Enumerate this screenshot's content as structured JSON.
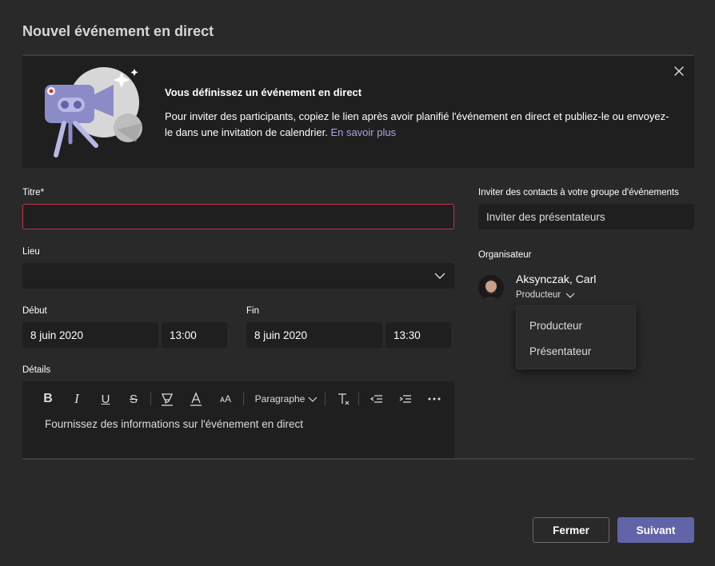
{
  "dialog": {
    "title": "Nouvel événement en direct"
  },
  "banner": {
    "title": "Vous définissez un événement en direct",
    "text": "Pour inviter des participants, copiez le lien après avoir planifié l'événement en direct et publiez-le ou envoyez-le dans une invitation de calendrier.",
    "link": "En savoir plus"
  },
  "form": {
    "title_label": "Titre*",
    "title_value": "",
    "location_label": "Lieu",
    "start_label": "Début",
    "start_date": "8 juin 2020",
    "start_time": "13:00",
    "end_label": "Fin",
    "end_date": "8 juin 2020",
    "end_time": "13:30",
    "details_label": "Détails",
    "details_placeholder": "Fournissez des informations sur l'événement en direct",
    "toolbar": {
      "paragraph": "Paragraphe"
    }
  },
  "invite": {
    "label": "Inviter des contacts à votre groupe d'événements",
    "placeholder": "Inviter des présentateurs"
  },
  "organizer": {
    "label": "Organisateur",
    "name": "Aksynczak, Carl",
    "role": "Producteur",
    "role_options": [
      "Producteur",
      "Présentateur"
    ]
  },
  "actions": {
    "close": "Fermer",
    "next": "Suivant"
  },
  "colors": {
    "accent": "#6264a7",
    "error_border": "#c4314b",
    "link": "#a6a7dc"
  }
}
